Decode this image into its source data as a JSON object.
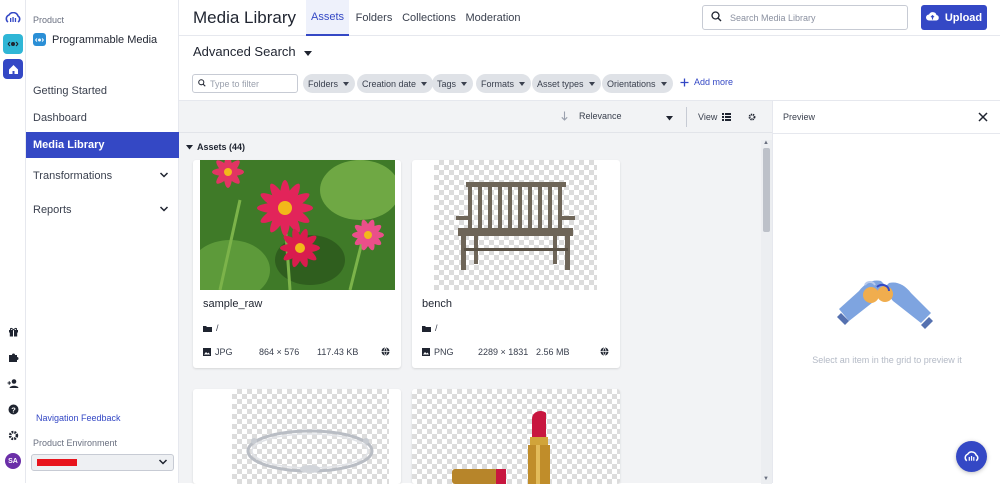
{
  "colors": {
    "accent": "#3448c5",
    "env_redaction": "#e8141d",
    "avatar": "#6b2fa8"
  },
  "rail": {
    "avatar_initials": "SA",
    "icons": [
      "cloudinary-logo-icon",
      "programmable-media-icon",
      "home-icon",
      "gift-icon",
      "puzzle-icon",
      "add-user-icon",
      "help-icon",
      "gear-icon"
    ]
  },
  "sidebar": {
    "product_label": "Product",
    "product_name": "Programmable Media",
    "items": [
      {
        "label": "Getting Started"
      },
      {
        "label": "Dashboard"
      },
      {
        "label": "Media Library",
        "active": true
      },
      {
        "label": "Transformations",
        "expandable": true
      },
      {
        "label": "Reports",
        "expandable": true
      }
    ],
    "feedback_link": "Navigation Feedback",
    "env_label": "Product Environment"
  },
  "header": {
    "title": "Media Library",
    "tabs": [
      {
        "label": "Assets",
        "active": true
      },
      {
        "label": "Folders"
      },
      {
        "label": "Collections"
      },
      {
        "label": "Moderation"
      }
    ],
    "search_placeholder": "Search Media Library",
    "upload_label": "Upload"
  },
  "advanced_search": {
    "title": "Advanced Search",
    "filter_placeholder": "Type to filter",
    "chips": [
      "Folders",
      "Creation date",
      "Tags",
      "Formats",
      "Asset types",
      "Orientations"
    ],
    "add_more": "Add more"
  },
  "toolbar": {
    "sort_label": "Relevance",
    "view_label": "View"
  },
  "assets": {
    "header": "Assets (44)",
    "items": [
      {
        "name": "sample_raw",
        "folder": "/",
        "format": "JPG",
        "dimensions": "864 × 576",
        "size": "117.43 KB",
        "thumbnail": "flowers"
      },
      {
        "name": "bench",
        "folder": "/",
        "format": "PNG",
        "dimensions": "2289 × 1831",
        "size": "2.56 MB",
        "thumbnail": "bench"
      },
      {
        "name": "",
        "thumbnail": "bracelet"
      },
      {
        "name": "",
        "thumbnail": "lipstick"
      }
    ]
  },
  "preview": {
    "title": "Preview",
    "empty_text": "Select an item in the grid to preview it"
  }
}
